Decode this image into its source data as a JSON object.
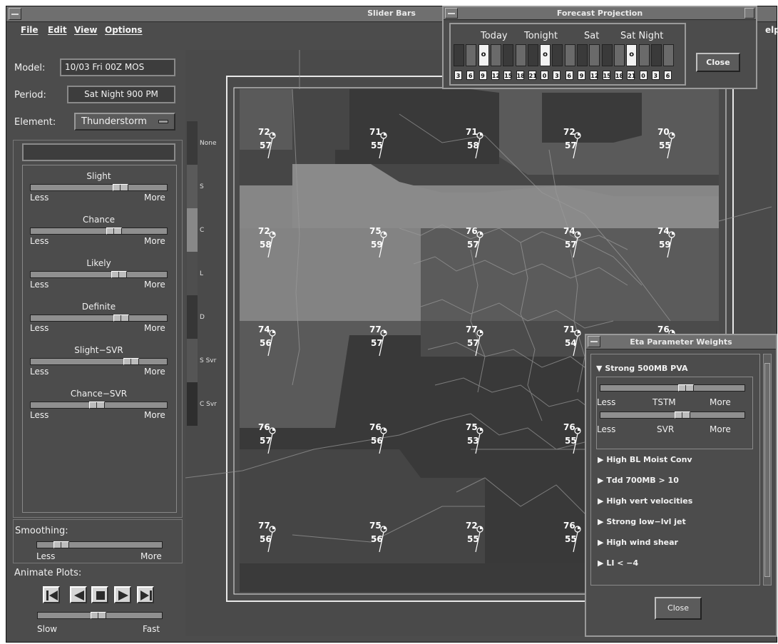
{
  "main_window": {
    "title": "Slider Bars"
  },
  "menubar": {
    "items": [
      "File",
      "Edit",
      "View",
      "Options"
    ],
    "help_fragment": "elp"
  },
  "controls": {
    "model_label": "Model:",
    "model_value": "10/03  Fri  00Z  MOS",
    "period_label": "Period:",
    "period_value": "Sat Night    900 PM",
    "element_label": "Element:",
    "element_value": "Thunderstorm"
  },
  "sliders": [
    {
      "title": "Slight",
      "less": "Less",
      "more": "More",
      "value": 0.67
    },
    {
      "title": "Chance",
      "less": "Less",
      "more": "More",
      "value": 0.62
    },
    {
      "title": "Likely",
      "less": "Less",
      "more": "More",
      "value": 0.66
    },
    {
      "title": "Definite",
      "less": "Less",
      "more": "More",
      "value": 0.68
    },
    {
      "title": "Slight−SVR",
      "less": "Less",
      "more": "More",
      "value": 0.76
    },
    {
      "title": "Chance−SVR",
      "less": "Less",
      "more": "More",
      "value": 0.48
    }
  ],
  "smoothing": {
    "title": "Smoothing:",
    "less": "Less",
    "more": "More",
    "value": 0.15
  },
  "animate": {
    "title": "Animate Plots:",
    "slow": "Slow",
    "fast": "Fast",
    "value": 0.48,
    "buttons": [
      "first-frame-icon",
      "step-back-icon",
      "stop-icon",
      "step-forward-icon",
      "last-frame-icon"
    ]
  },
  "legend": [
    {
      "label": "None",
      "color": "#3a3a3a"
    },
    {
      "label": "S",
      "color": "#5a5a5a"
    },
    {
      "label": "C",
      "color": "#888888"
    },
    {
      "label": "L",
      "color": "#4e4e4e"
    },
    {
      "label": "D",
      "color": "#363636"
    },
    {
      "label": "S Svr",
      "color": "#555555"
    },
    {
      "label": "C Svr",
      "color": "#2e2e2e"
    }
  ],
  "stations": [
    {
      "t": "72",
      "d": "57"
    },
    {
      "t": "71",
      "d": "55"
    },
    {
      "t": "71",
      "d": "58"
    },
    {
      "t": "72",
      "d": "57"
    },
    {
      "t": "70",
      "d": "55"
    },
    {
      "t": "72",
      "d": "58"
    },
    {
      "t": "75",
      "d": "59"
    },
    {
      "t": "76",
      "d": "57"
    },
    {
      "t": "74",
      "d": "57"
    },
    {
      "t": "74",
      "d": "59"
    },
    {
      "t": "74",
      "d": "56"
    },
    {
      "t": "77",
      "d": "57"
    },
    {
      "t": "77",
      "d": "57"
    },
    {
      "t": "71",
      "d": "54"
    },
    {
      "t": "76",
      "d": ""
    },
    {
      "t": "76",
      "d": "57"
    },
    {
      "t": "76",
      "d": "56"
    },
    {
      "t": "75",
      "d": "53"
    },
    {
      "t": "76",
      "d": "55"
    },
    {
      "t": "77",
      "d": "56"
    },
    {
      "t": "75",
      "d": "56"
    },
    {
      "t": "72",
      "d": "55"
    },
    {
      "t": "76",
      "d": "55"
    }
  ],
  "forecast_projection": {
    "title": "Forecast Projection",
    "headers": [
      "Today",
      "Tonight",
      "Sat",
      "Sat Night"
    ],
    "hours": [
      "3",
      "6",
      "9",
      "12",
      "15",
      "18",
      "21",
      "0",
      "3",
      "6",
      "9",
      "12",
      "15",
      "18",
      "21",
      "0",
      "3",
      "6"
    ],
    "markers": [
      "",
      "",
      "o",
      "",
      "",
      "",
      "",
      "o",
      "",
      "",
      "",
      "",
      "",
      "",
      "o",
      "",
      "",
      ""
    ],
    "close_label": "Close"
  },
  "eta_weights": {
    "title": "Eta Parameter Weights",
    "expanded_item": "Strong 500MB PVA",
    "tstm": {
      "label": "TSTM",
      "less": "Less",
      "more": "More",
      "value": 0.6
    },
    "svr": {
      "label": "SVR",
      "less": "Less",
      "more": "More",
      "value": 0.57
    },
    "items": [
      "High BL Moist Conv",
      "Tdd 700MB > 10",
      "High vert velocities",
      "Strong low−lvl jet",
      "High wind shear",
      "LI < −4"
    ],
    "close_label": "Close"
  }
}
